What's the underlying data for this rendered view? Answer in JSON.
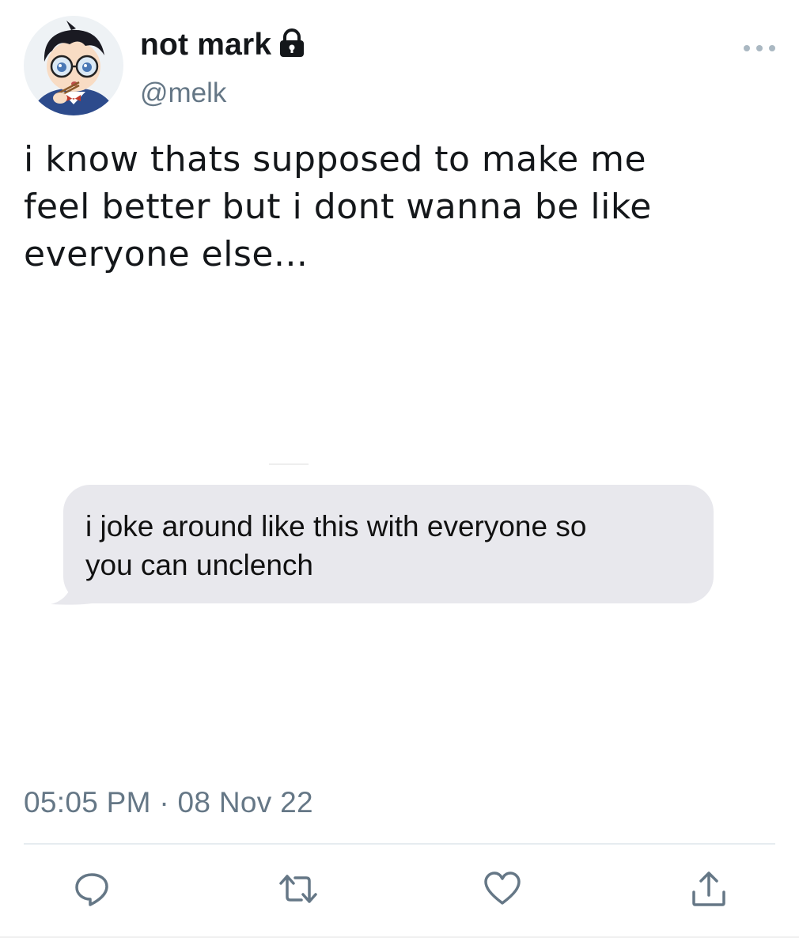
{
  "author": {
    "display_name": "not mark",
    "handle": "@melk",
    "avatar_icon": "anime-avatar",
    "protected_icon": "lock-icon"
  },
  "tweet": {
    "text": "i know thats supposed to make me\nfeel better but i dont wanna be like\neveryone else...",
    "timestamp": "05:05 PM · 08 Nov 22"
  },
  "media": {
    "message_bubble_text": "i joke around like this with everyone so\nyou can unclench"
  },
  "actions": {
    "reply_icon": "reply-icon",
    "retweet_icon": "retweet-icon",
    "like_icon": "heart-icon",
    "share_icon": "share-icon",
    "more_icon": "more-icon"
  },
  "colors": {
    "text_primary": "#14171a",
    "text_secondary": "#657786",
    "icon_gray": "#657786",
    "bubble_gray": "#e8e8ed",
    "divider": "#e6ecf0"
  }
}
